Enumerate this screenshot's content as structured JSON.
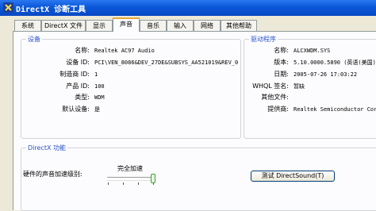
{
  "window": {
    "title": "DirectX 诊断工具"
  },
  "tabs": [
    {
      "label": "系统"
    },
    {
      "label": "DirectX 文件"
    },
    {
      "label": "显示"
    },
    {
      "label": "声音"
    },
    {
      "label": "音乐"
    },
    {
      "label": "输入"
    },
    {
      "label": "网络"
    },
    {
      "label": "其他帮助"
    }
  ],
  "active_tab": "声音",
  "device": {
    "title": "设备",
    "fields": [
      {
        "label": "名称:",
        "value": "Realtek AC97 Audio"
      },
      {
        "label": "设备 ID:",
        "value": "PCI\\VEN_8086&DEV_27DE&SUBSYS_AA521019&REV_0"
      },
      {
        "label": "制造商 ID:",
        "value": "1"
      },
      {
        "label": "产品 ID:",
        "value": "100"
      },
      {
        "label": "类型:",
        "value": "WDM"
      },
      {
        "label": "默认设备:",
        "value": "是"
      }
    ]
  },
  "driver": {
    "title": "驱动程序",
    "fields": [
      {
        "label": "名称:",
        "value": "ALCXWDM.SYS"
      },
      {
        "label": "版本:",
        "value": "5.10.0000.5890 (英语(美国)"
      },
      {
        "label": "日期:",
        "value": "2005-07-26 17:03:22"
      },
      {
        "label": "WHQL 签名:",
        "value": "暂缺"
      },
      {
        "label": "其他文件:",
        "value": ""
      },
      {
        "label": "提供商:",
        "value": "Realtek Semiconductor Corp."
      }
    ]
  },
  "directx": {
    "title": "DirectX 功能",
    "accel_label": "硬件的声音加速级别:",
    "accel_value_label": "完全加速",
    "accel_level": 1.0,
    "test_button": "测试 DirectSound(T)"
  },
  "colors": {
    "titlebar": "#0a58d8",
    "group_title": "#2a54c8",
    "active_tab_accent": "#e8a838"
  }
}
